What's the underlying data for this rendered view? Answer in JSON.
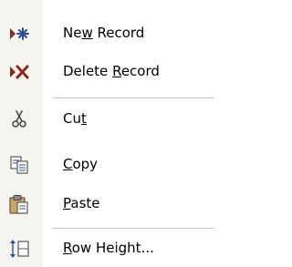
{
  "menu": {
    "items": [
      {
        "id": "new-record",
        "label_pre": "Ne",
        "label_key": "w",
        "label_post": " Record",
        "icon": "new-record-icon"
      },
      {
        "id": "delete-record",
        "label_pre": "Delete ",
        "label_key": "R",
        "label_post": "ecord",
        "icon": "delete-record-icon"
      },
      {
        "id": "cut",
        "label_pre": "Cu",
        "label_key": "t",
        "label_post": "",
        "icon": "scissors-icon"
      },
      {
        "id": "copy",
        "label_pre": "",
        "label_key": "C",
        "label_post": "opy",
        "icon": "copy-icon"
      },
      {
        "id": "paste",
        "label_pre": "",
        "label_key": "P",
        "label_post": "aste",
        "icon": "paste-icon"
      },
      {
        "id": "row-height",
        "label_pre": "",
        "label_key": "R",
        "label_post": "ow Height...",
        "icon": "row-height-icon"
      }
    ]
  },
  "colors": {
    "icon_accent": "#8a2b1a",
    "icon_blue": "#2b4f9a",
    "separator": "#c5c2b8"
  }
}
